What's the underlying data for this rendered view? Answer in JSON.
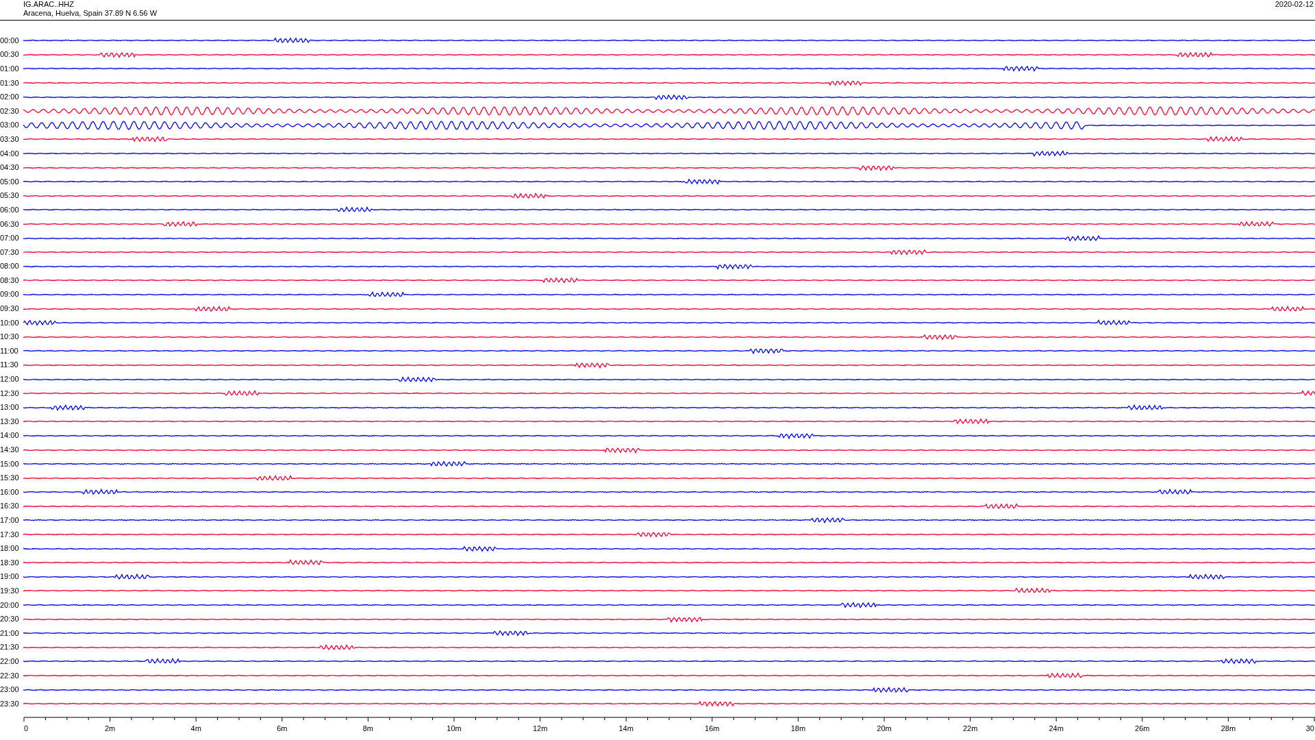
{
  "header": {
    "station": "IG.ARAC..HHZ",
    "location": "Aracena, Huelva, Spain  37.89 N 6.56 W",
    "date": "2020-02-12"
  },
  "rows": [
    {
      "label": "00:00",
      "color": "#0000ff",
      "kind": "quiet"
    },
    {
      "label": "00:30",
      "color": "#ff0033",
      "kind": "quiet"
    },
    {
      "label": "01:00",
      "color": "#0000ff",
      "kind": "quiet"
    },
    {
      "label": "01:30",
      "color": "#ff0033",
      "kind": "quiet"
    },
    {
      "label": "02:00",
      "color": "#0000ff",
      "kind": "quiet"
    },
    {
      "label": "02:30",
      "color": "#ff0033",
      "kind": "oscillating"
    },
    {
      "label": "03:00",
      "color": "#0000ff",
      "kind": "oscillating"
    },
    {
      "label": "03:30",
      "color": "#ff0033",
      "kind": "quiet"
    },
    {
      "label": "04:00",
      "color": "#0000ff",
      "kind": "quiet"
    },
    {
      "label": "04:30",
      "color": "#ff0033",
      "kind": "quiet"
    },
    {
      "label": "05:00",
      "color": "#0000ff",
      "kind": "quiet"
    },
    {
      "label": "05:30",
      "color": "#ff0033",
      "kind": "quiet"
    },
    {
      "label": "06:00",
      "color": "#0000ff",
      "kind": "quiet"
    },
    {
      "label": "06:30",
      "color": "#ff0033",
      "kind": "quiet"
    },
    {
      "label": "07:00",
      "color": "#0000ff",
      "kind": "quiet"
    },
    {
      "label": "07:30",
      "color": "#ff0033",
      "kind": "quiet"
    },
    {
      "label": "08:00",
      "color": "#0000ff",
      "kind": "quiet"
    },
    {
      "label": "08:30",
      "color": "#ff0033",
      "kind": "quiet"
    },
    {
      "label": "09:00",
      "color": "#0000ff",
      "kind": "quiet"
    },
    {
      "label": "09:30",
      "color": "#ff0033",
      "kind": "quiet"
    },
    {
      "label": "10:00",
      "color": "#0000ff",
      "kind": "quiet"
    },
    {
      "label": "10:30",
      "color": "#ff0033",
      "kind": "quiet"
    },
    {
      "label": "11:00",
      "color": "#0000ff",
      "kind": "quiet"
    },
    {
      "label": "11:30",
      "color": "#ff0033",
      "kind": "quiet"
    },
    {
      "label": "12:00",
      "color": "#0000ff",
      "kind": "quiet"
    },
    {
      "label": "12:30",
      "color": "#ff0033",
      "kind": "quiet"
    },
    {
      "label": "13:00",
      "color": "#0000ff",
      "kind": "quiet"
    },
    {
      "label": "13:30",
      "color": "#ff0033",
      "kind": "quiet"
    },
    {
      "label": "14:00",
      "color": "#0000ff",
      "kind": "quiet"
    },
    {
      "label": "14:30",
      "color": "#ff0033",
      "kind": "quiet"
    },
    {
      "label": "15:00",
      "color": "#0000ff",
      "kind": "quiet"
    },
    {
      "label": "15:30",
      "color": "#ff0033",
      "kind": "quiet"
    },
    {
      "label": "16:00",
      "color": "#0000ff",
      "kind": "quiet"
    },
    {
      "label": "16:30",
      "color": "#ff0033",
      "kind": "quiet"
    },
    {
      "label": "17:00",
      "color": "#0000ff",
      "kind": "quiet"
    },
    {
      "label": "17:30",
      "color": "#ff0033",
      "kind": "quiet"
    },
    {
      "label": "18:00",
      "color": "#0000ff",
      "kind": "quiet"
    },
    {
      "label": "18:30",
      "color": "#ff0033",
      "kind": "quiet"
    },
    {
      "label": "19:00",
      "color": "#0000ff",
      "kind": "quiet"
    },
    {
      "label": "19:30",
      "color": "#ff0033",
      "kind": "quiet"
    },
    {
      "label": "20:00",
      "color": "#0000ff",
      "kind": "quiet"
    },
    {
      "label": "20:30",
      "color": "#ff0033",
      "kind": "quiet"
    },
    {
      "label": "21:00",
      "color": "#0000ff",
      "kind": "quiet"
    },
    {
      "label": "21:30",
      "color": "#ff0033",
      "kind": "quiet"
    },
    {
      "label": "22:00",
      "color": "#0000ff",
      "kind": "quiet"
    },
    {
      "label": "22:30",
      "color": "#ff0033",
      "kind": "quiet"
    },
    {
      "label": "23:00",
      "color": "#0000ff",
      "kind": "quiet"
    },
    {
      "label": "23:30",
      "color": "#ff0033",
      "kind": "quiet"
    }
  ],
  "x_axis": {
    "tick_labels": [
      "0",
      "2m",
      "4m",
      "6m",
      "8m",
      "10m",
      "12m",
      "14m",
      "16m",
      "18m",
      "20m",
      "22m",
      "24m",
      "26m",
      "28m",
      "30"
    ]
  }
}
